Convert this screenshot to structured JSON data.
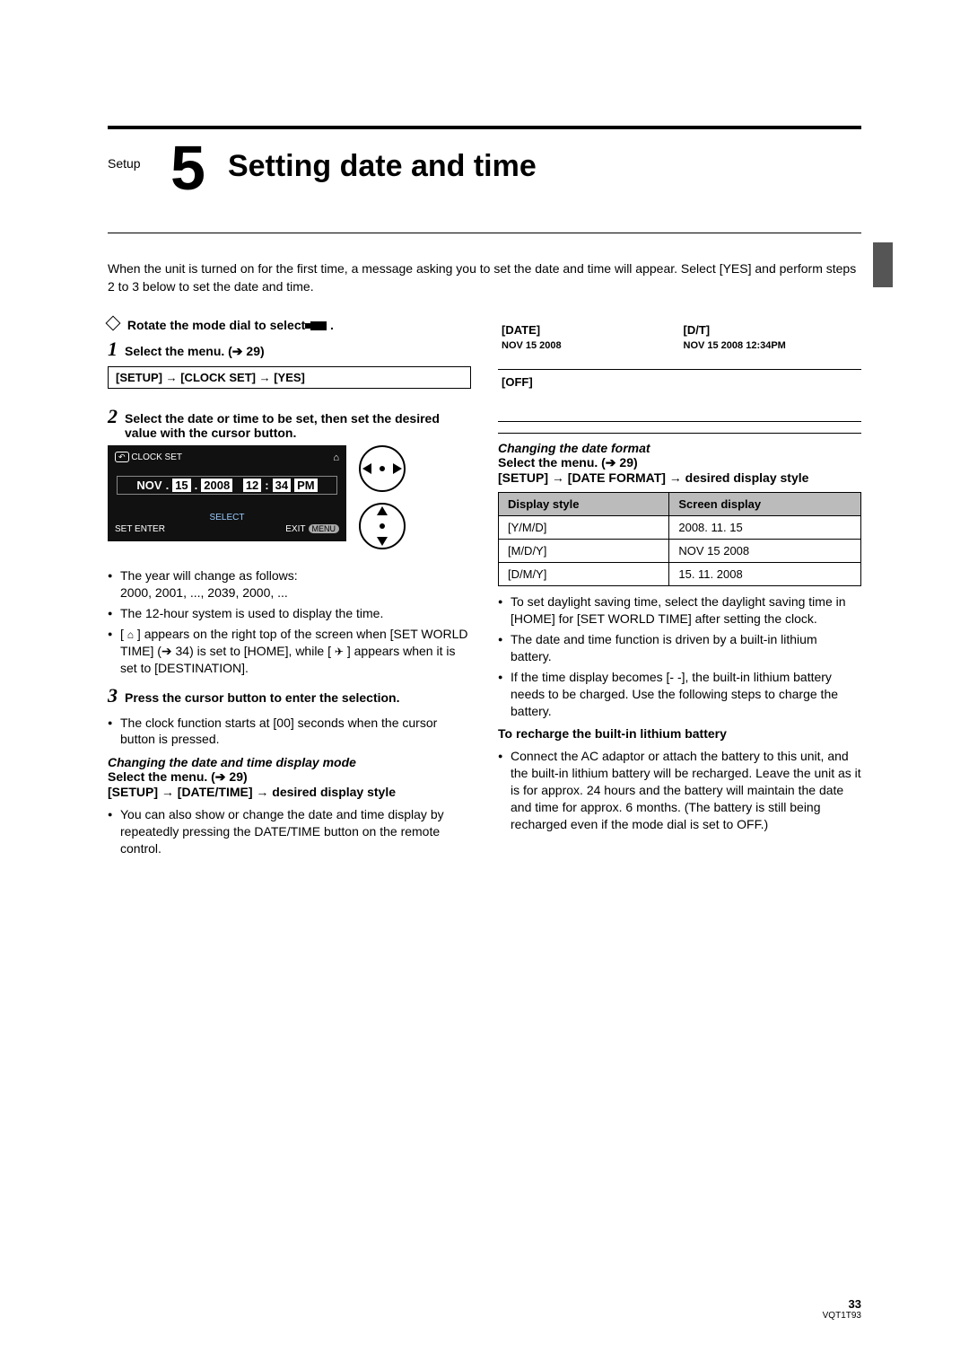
{
  "header": {
    "section": "Setup",
    "number": "5",
    "title": "Setting date and time"
  },
  "intro": "When the unit is turned on for the first time, a message asking you to set the date and time will appear. Select [YES] and perform steps 2 to 3 below to set the date and time.",
  "left": {
    "rotate": "Rotate the mode dial to select ",
    "step1": "Select the menu. (➔ 29)",
    "menu_path": "[SETUP] → [CLOCK SET] → [YES]",
    "step2": "Select the date or time to be set, then set the desired value with the cursor button.",
    "lcd": {
      "title": "CLOCK SET",
      "nov": "NOV",
      "dot1": ".",
      "d15": "15",
      "dot2": ".",
      "y2008": "2008",
      "h12": "12",
      "colon": ":",
      "m34": "34",
      "pm": "PM",
      "select": "SELECT",
      "set_enter": "SET     ENTER",
      "exit": "EXIT",
      "menu": "MENU"
    },
    "bul1": "The year will change as follows:",
    "bul1b": "2000, 2001, ..., 2039, 2000, ...",
    "bul2": "The 12-hour system is used to display the time.",
    "bul3a": "[ ",
    "bul3b": " ] appears on the right top of the screen when [SET WORLD TIME] (➔ 34) is set to [HOME], while [ ",
    "bul3c": " ] appears when it is set to [DESTINATION].",
    "step3": "Press the cursor button to enter the selection.",
    "bul4": "The clock function starts at [00] seconds when the cursor button is pressed.",
    "chg_mode_title": "Changing the date and time display mode",
    "chg_mode_sel": "Select the menu. (➔ 29)",
    "chg_mode_path": "[SETUP] → [DATE/TIME] → desired display style",
    "bul5": "You can also show or change the date and time display by repeatedly pressing the DATE/TIME button on the remote control."
  },
  "right": {
    "mode_table": {
      "r1c1_h": "[DATE]",
      "r1c1_v": "NOV 15 2008",
      "r1c2_h": "[D/T]",
      "r1c2_v": "NOV 15 2008  12:34PM",
      "r2c1_h": "[OFF]"
    },
    "chg_fmt_title": "Changing the date format",
    "chg_fmt_sel": "Select the menu. (➔ 29)",
    "chg_fmt_path": "[SETUP] → [DATE FORMAT] → desired display style",
    "fmt_table": {
      "h1": "Display style",
      "h2": "Screen display",
      "r1c1": "[Y/M/D]",
      "r1c2": "2008. 11. 15",
      "r2c1": "[M/D/Y]",
      "r2c2": "NOV 15 2008",
      "r3c1": "[D/M/Y]",
      "r3c2": "15. 11. 2008"
    },
    "bulA": "To set daylight saving time, select the daylight saving time in [HOME] for [SET WORLD TIME] after setting the clock.",
    "bulB": "The date and time function is driven by a built-in lithium battery.",
    "bulC": "If the time display becomes [- -], the built-in lithium battery needs to be charged. Use the following steps to charge the battery.",
    "recharge_h": "To recharge the built-in lithium battery",
    "bulD": "Connect the AC adaptor or attach the battery to this unit, and the built-in lithium battery will be recharged. Leave the unit as it is for approx. 24 hours and the battery will maintain the date and time for approx. 6 months. (The battery is still being recharged even if the mode dial is set to OFF.)"
  },
  "footer": {
    "page": "33",
    "code": "VQT1T93"
  }
}
